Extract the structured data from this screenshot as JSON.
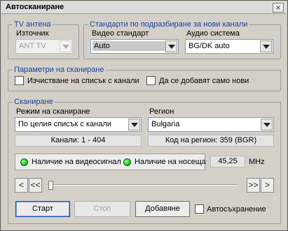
{
  "window": {
    "title": "Автосканиране",
    "close_glyph": "×"
  },
  "tv_antenna": {
    "legend": "TV антена",
    "source_label": "Източник",
    "source_value": "ANT TV"
  },
  "defaults": {
    "legend": "Стандарти по подразбиране за нови канали",
    "video_label": "Видео стандарт",
    "video_value": "Auto",
    "audio_label": "Аудио система",
    "audio_value": "BG/DK auto"
  },
  "scan_params": {
    "legend": "Параметри на сканиране",
    "clear_list_label": "Изчистване на списък с канали",
    "add_new_only_label": "Да се добавят само нови"
  },
  "scanning": {
    "legend": "Сканиране",
    "mode_label": "Режим на сканиране",
    "mode_value": "По целия списък с канали",
    "region_label": "Регион",
    "region_value": "Bulgaria",
    "channels_info": "Канали: 1 - 404",
    "region_code_info": "Код на регион: 359 (BGR)",
    "video_signal_label": "Наличие на видеосигнал",
    "carrier_label": "Наличие на носеща",
    "frequency_value": "45,25",
    "frequency_unit": "MHz",
    "nav_first": "<",
    "nav_prev": "<<",
    "nav_next": ">>",
    "nav_last": ">",
    "slider_position": 0
  },
  "buttons": {
    "start": "Старт",
    "stop": "Стоп",
    "add": "Добавяне",
    "autosave_label": "Автосъхранение"
  },
  "colors": {
    "legend_text": "#1c3f9e",
    "led_on": "#21c321",
    "window_bg": "#d4d0c8"
  }
}
